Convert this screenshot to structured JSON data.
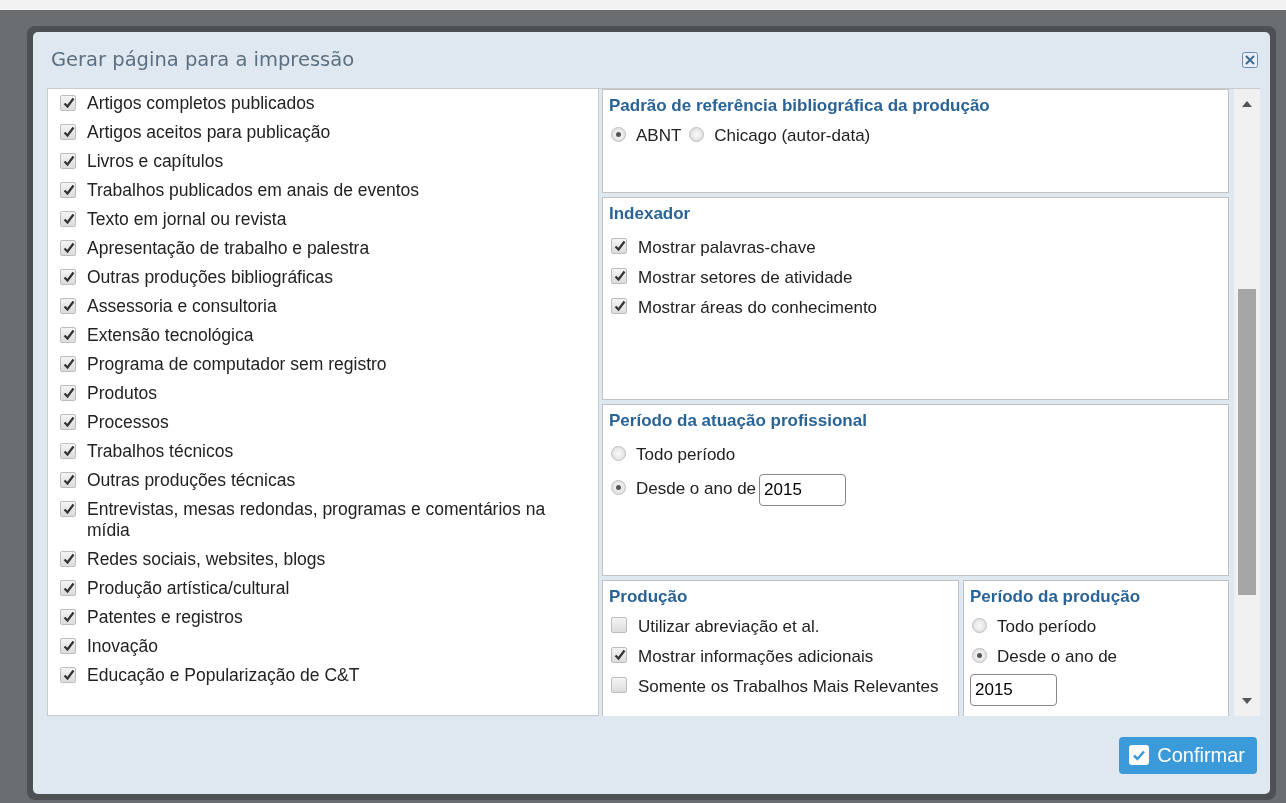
{
  "dialog": {
    "title": "Gerar página para a impressão"
  },
  "production_types": [
    {
      "label": "Artigos completos publicados",
      "checked": true
    },
    {
      "label": "Artigos aceitos para publicação",
      "checked": true
    },
    {
      "label": "Livros e capítulos",
      "checked": true
    },
    {
      "label": "Trabalhos publicados em anais de eventos",
      "checked": true
    },
    {
      "label": "Texto em jornal ou revista",
      "checked": true
    },
    {
      "label": "Apresentação de trabalho e palestra",
      "checked": true
    },
    {
      "label": "Outras produções bibliográficas",
      "checked": true
    },
    {
      "label": "Assessoria e consultoria",
      "checked": true
    },
    {
      "label": "Extensão tecnológica",
      "checked": true
    },
    {
      "label": "Programa de computador sem registro",
      "checked": true
    },
    {
      "label": "Produtos",
      "checked": true
    },
    {
      "label": "Processos",
      "checked": true
    },
    {
      "label": "Trabalhos técnicos",
      "checked": true
    },
    {
      "label": "Outras produções técnicas",
      "checked": true
    },
    {
      "label": "Entrevistas, mesas redondas, programas e comentários na mídia",
      "checked": true
    },
    {
      "label": "Redes sociais, websites, blogs",
      "checked": true
    },
    {
      "label": "Produção artística/cultural",
      "checked": true
    },
    {
      "label": "Patentes e registros",
      "checked": true
    },
    {
      "label": "Inovação",
      "checked": true
    },
    {
      "label": "Educação e Popularização de C&T",
      "checked": true
    }
  ],
  "reference_standard": {
    "title": "Padrão de referência bibliográfica da produção",
    "options": [
      {
        "label": "ABNT",
        "selected": true
      },
      {
        "label": "Chicago (autor-data)",
        "selected": false
      }
    ]
  },
  "indexer": {
    "title": "Indexador",
    "options": [
      {
        "label": "Mostrar palavras-chave",
        "checked": true
      },
      {
        "label": "Mostrar setores de atividade",
        "checked": true
      },
      {
        "label": "Mostrar áreas do conhecimento",
        "checked": true
      }
    ]
  },
  "professional_period": {
    "title": "Período da atuação profissional",
    "options": [
      {
        "label": "Todo período",
        "selected": false
      },
      {
        "label": "Desde o ano de",
        "selected": true
      }
    ],
    "year": "2015"
  },
  "production": {
    "title": "Produção",
    "options": [
      {
        "label": "Utilizar abreviação et al.",
        "checked": false
      },
      {
        "label": "Mostrar informações adicionais",
        "checked": true
      },
      {
        "label": "Somente os Trabalhos Mais Relevantes",
        "checked": false
      }
    ]
  },
  "production_period": {
    "title": "Período da produção",
    "options": [
      {
        "label": "Todo período",
        "selected": false
      },
      {
        "label": "Desde o ano de",
        "selected": true
      }
    ],
    "year": "2015"
  },
  "confirm_button": "Confirmar"
}
